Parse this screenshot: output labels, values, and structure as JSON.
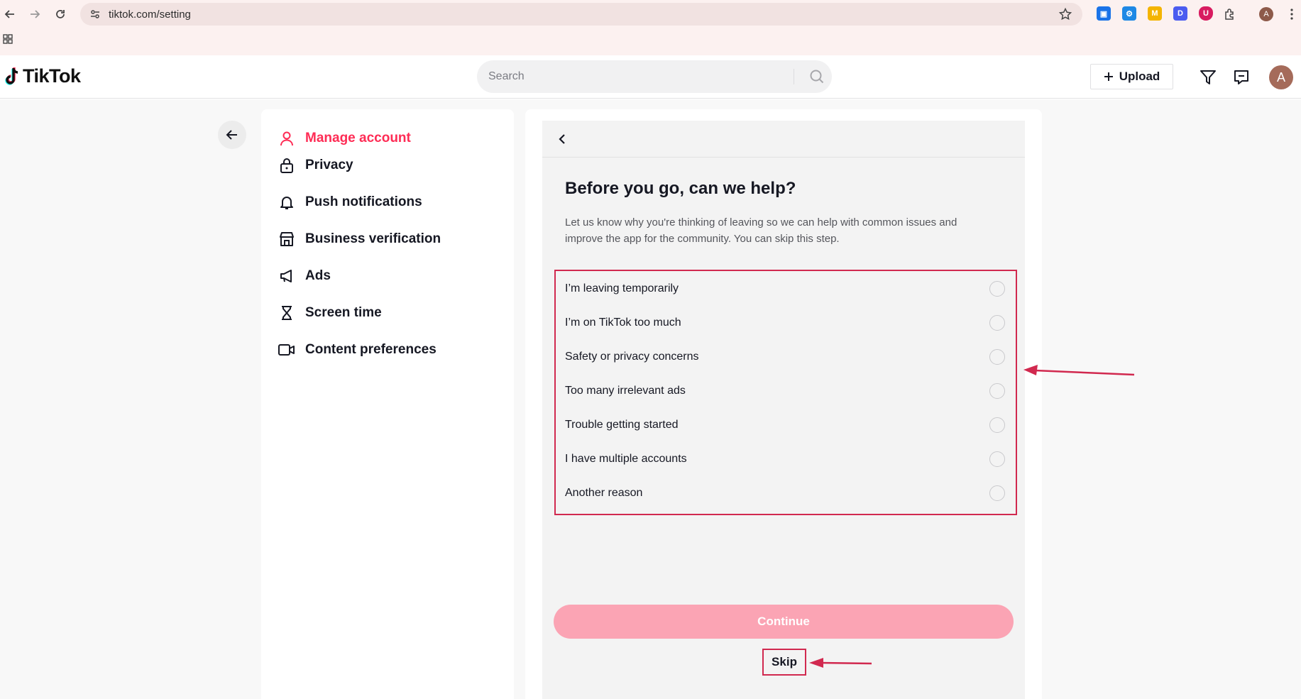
{
  "browser": {
    "url": "tiktok.com/setting",
    "profile_initial": "A",
    "extensions": [
      {
        "name": "screenshot-extension-icon",
        "color": "#1a73e8",
        "glyph": "▣"
      },
      {
        "name": "settings-extension-icon",
        "color": "#1e88e5",
        "glyph": "⚙"
      },
      {
        "name": "mail-extension-icon",
        "color": "#f4b400",
        "glyph": "M"
      },
      {
        "name": "d-extension-icon",
        "color": "#4b5cf0",
        "glyph": "D"
      },
      {
        "name": "shield-extension-icon",
        "color": "#d81b60",
        "glyph": "U"
      }
    ]
  },
  "header": {
    "logo_text": "TikTok",
    "search_placeholder": "Search",
    "upload_label": "Upload",
    "avatar_initial": "A"
  },
  "sidebar": {
    "items": [
      {
        "label": "Manage account",
        "icon": "person-icon",
        "active": true
      },
      {
        "label": "Privacy",
        "icon": "lock-icon"
      },
      {
        "label": "Push notifications",
        "icon": "bell-icon"
      },
      {
        "label": "Business verification",
        "icon": "store-icon"
      },
      {
        "label": "Ads",
        "icon": "megaphone-icon"
      },
      {
        "label": "Screen time",
        "icon": "hourglass-icon"
      },
      {
        "label": "Content preferences",
        "icon": "video-icon"
      }
    ]
  },
  "dialog": {
    "title": "Before you go, can we help?",
    "description": "Let us know why you're thinking of leaving so we can help with common issues and improve the app for the community. You can skip this step.",
    "options": [
      "I’m leaving temporarily",
      "I’m on TikTok too much",
      "Safety or privacy concerns",
      "Too many irrelevant ads",
      "Trouble getting started",
      "I have multiple accounts",
      "Another reason"
    ],
    "continue_label": "Continue",
    "skip_label": "Skip"
  },
  "colors": {
    "brand": "#fe2c55",
    "annotation": "#d1294f",
    "continue_disabled": "#fba4b4"
  }
}
